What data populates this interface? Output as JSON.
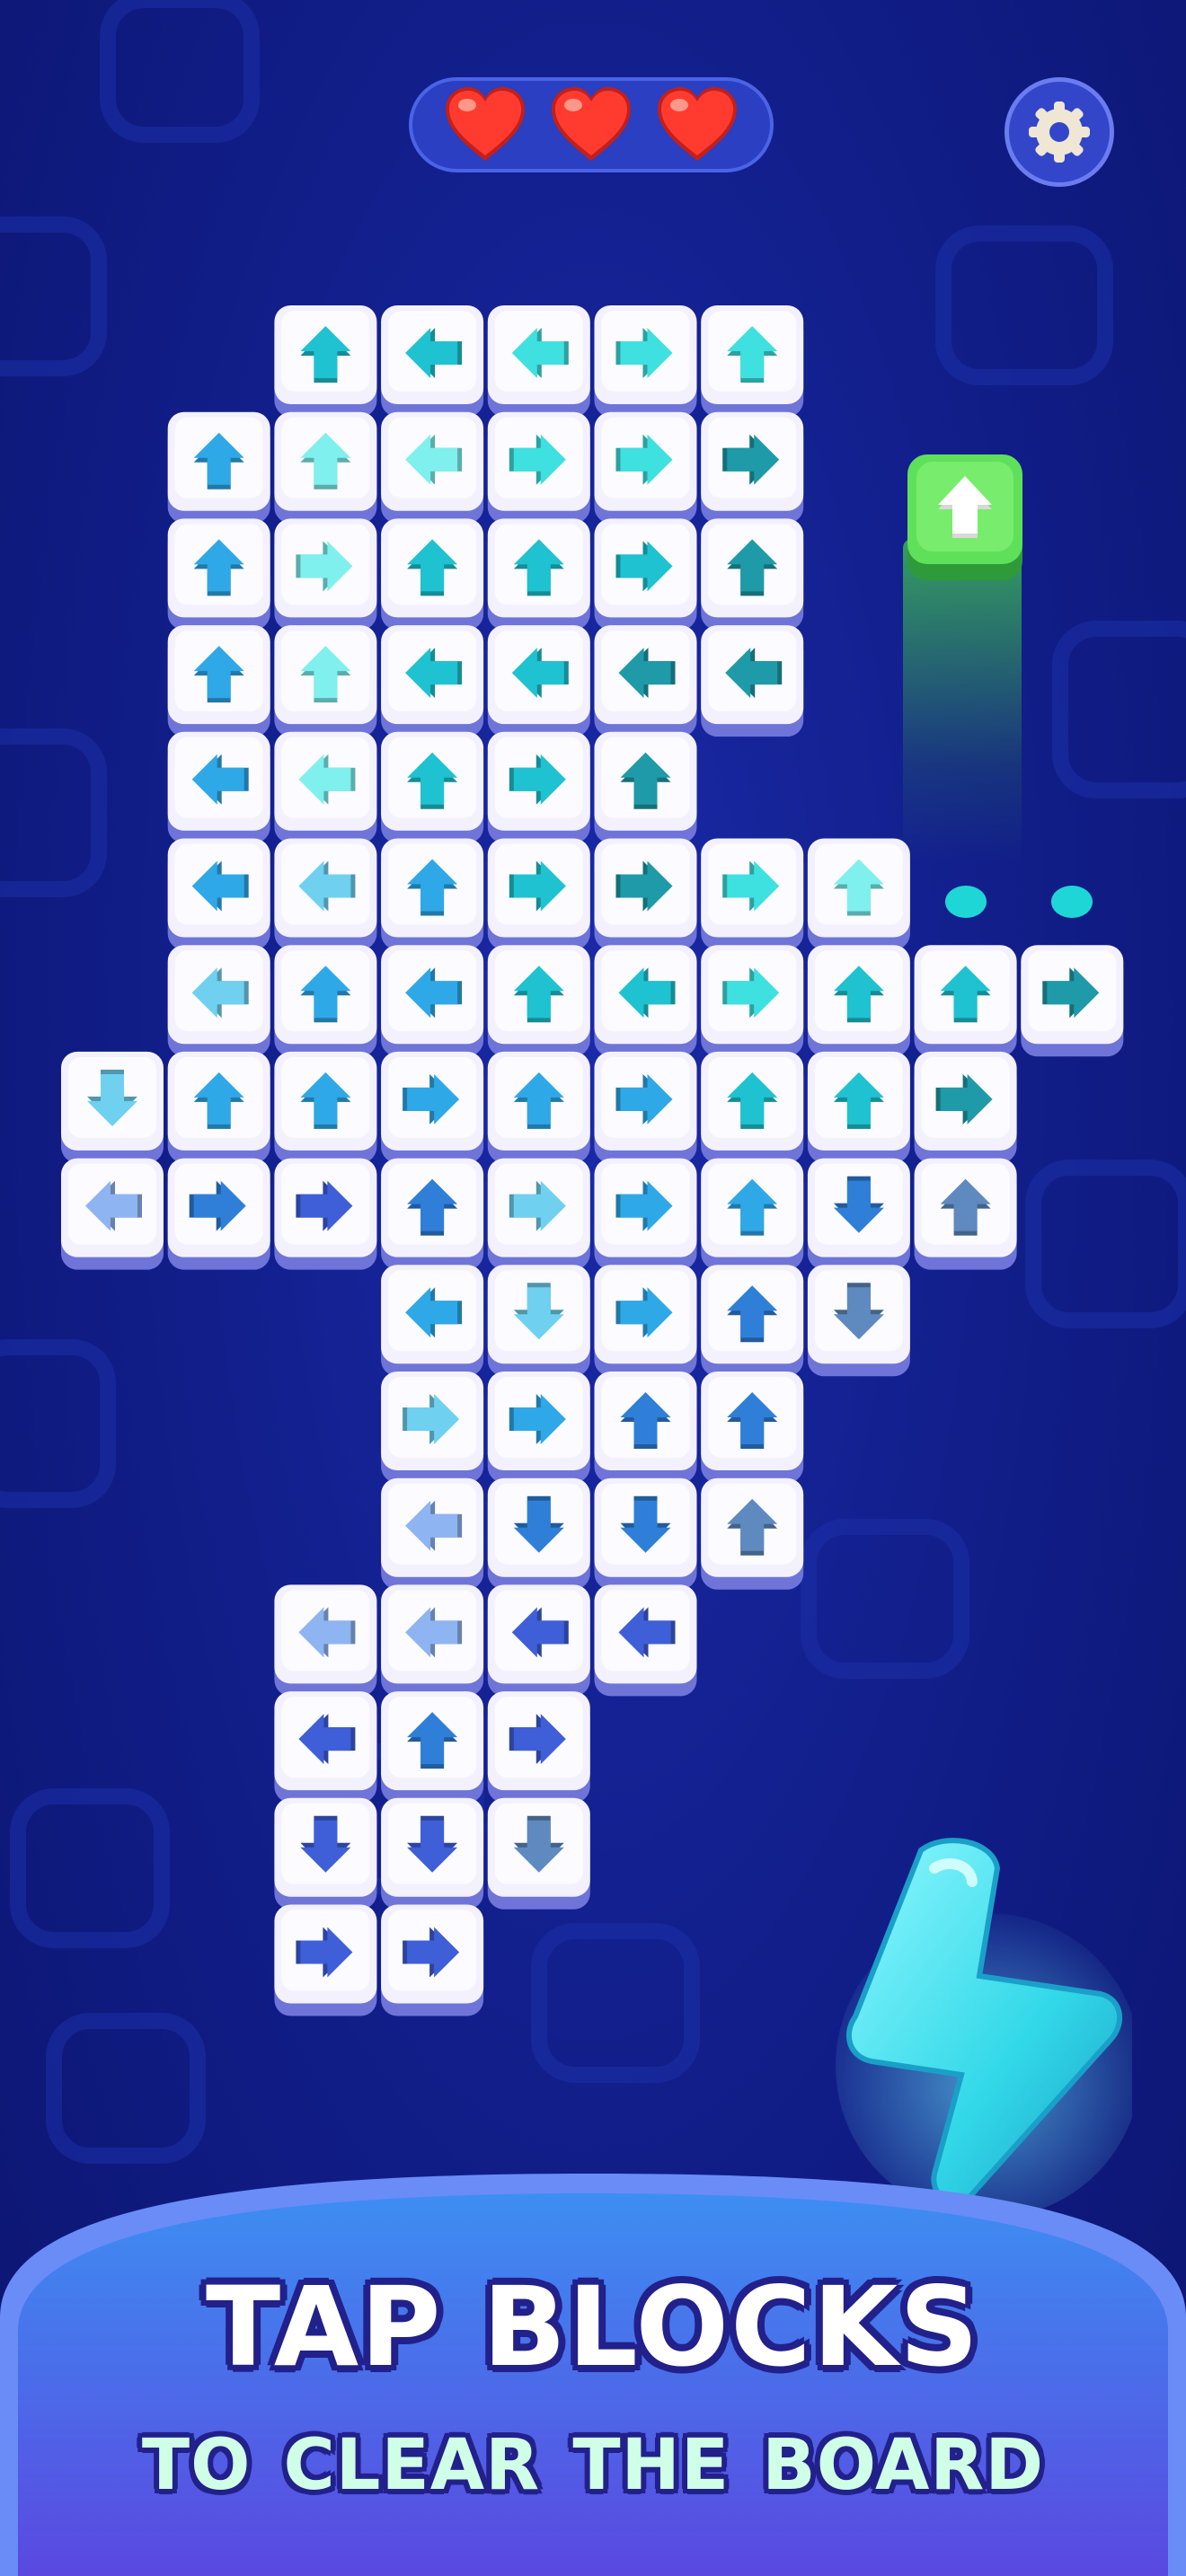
{
  "hud": {
    "lives": 3,
    "heart_icon": "heart-icon",
    "settings_icon": "gear-icon",
    "colors": {
      "heart": "#ff3b2f",
      "pill": "#2a3fc2",
      "settings_ring": "#6a7cf0"
    }
  },
  "board": {
    "tile_colors": {
      "teal": "#1fc2d0",
      "aqua": "#3fe0e0",
      "mint": "#7ff0ee",
      "dark_teal": "#1f9aa8",
      "light_blue": "#6fd0f0",
      "sky": "#2fa8e8",
      "blue": "#2f7fd8",
      "periwinkle": "#8fb4f2",
      "indigo": "#3f5fd8",
      "slate": "#5f8ac0"
    },
    "rows": [
      {
        "row": 0,
        "cells": [
          [
            2,
            "up",
            "teal"
          ],
          [
            3,
            "left",
            "teal"
          ],
          [
            4,
            "left",
            "aqua"
          ],
          [
            5,
            "right",
            "aqua"
          ],
          [
            6,
            "up",
            "aqua"
          ]
        ]
      },
      {
        "row": 1,
        "cells": [
          [
            1,
            "up",
            "sky"
          ],
          [
            2,
            "up",
            "mint"
          ],
          [
            3,
            "left",
            "mint"
          ],
          [
            4,
            "right",
            "aqua"
          ],
          [
            5,
            "right",
            "aqua"
          ],
          [
            6,
            "right",
            "dark_teal"
          ]
        ]
      },
      {
        "row": 2,
        "cells": [
          [
            1,
            "up",
            "sky"
          ],
          [
            2,
            "right",
            "mint"
          ],
          [
            3,
            "up",
            "teal"
          ],
          [
            4,
            "up",
            "teal"
          ],
          [
            5,
            "right",
            "teal"
          ],
          [
            6,
            "up",
            "dark_teal"
          ]
        ]
      },
      {
        "row": 3,
        "cells": [
          [
            1,
            "up",
            "sky"
          ],
          [
            2,
            "up",
            "mint"
          ],
          [
            3,
            "left",
            "teal"
          ],
          [
            4,
            "left",
            "teal"
          ],
          [
            5,
            "left",
            "dark_teal"
          ],
          [
            6,
            "left",
            "dark_teal"
          ]
        ]
      },
      {
        "row": 4,
        "cells": [
          [
            1,
            "left",
            "sky"
          ],
          [
            2,
            "left",
            "mint"
          ],
          [
            3,
            "up",
            "teal"
          ],
          [
            4,
            "right",
            "teal"
          ],
          [
            5,
            "up",
            "dark_teal"
          ]
        ]
      },
      {
        "row": 5,
        "cells": [
          [
            1,
            "left",
            "sky"
          ],
          [
            2,
            "left",
            "light_blue"
          ],
          [
            3,
            "up",
            "sky"
          ],
          [
            4,
            "right",
            "teal"
          ],
          [
            5,
            "right",
            "dark_teal"
          ],
          [
            6,
            "right",
            "aqua"
          ],
          [
            7,
            "up",
            "mint"
          ]
        ]
      },
      {
        "row": 6,
        "cells": [
          [
            1,
            "left",
            "light_blue"
          ],
          [
            2,
            "up",
            "sky"
          ],
          [
            3,
            "left",
            "sky"
          ],
          [
            4,
            "up",
            "teal"
          ],
          [
            5,
            "left",
            "teal"
          ],
          [
            6,
            "right",
            "aqua"
          ],
          [
            7,
            "up",
            "teal"
          ],
          [
            8,
            "up",
            "teal"
          ],
          [
            9,
            "right",
            "dark_teal"
          ]
        ]
      },
      {
        "row": 7,
        "cells": [
          [
            0,
            "down",
            "light_blue"
          ],
          [
            1,
            "up",
            "sky"
          ],
          [
            2,
            "up",
            "sky"
          ],
          [
            3,
            "right",
            "sky"
          ],
          [
            4,
            "up",
            "sky"
          ],
          [
            5,
            "right",
            "sky"
          ],
          [
            6,
            "up",
            "teal"
          ],
          [
            7,
            "up",
            "teal"
          ],
          [
            8,
            "right",
            "dark_teal"
          ]
        ]
      },
      {
        "row": 8,
        "cells": [
          [
            0,
            "left",
            "periwinkle"
          ],
          [
            1,
            "right",
            "blue"
          ],
          [
            2,
            "right",
            "indigo"
          ],
          [
            3,
            "up",
            "blue"
          ],
          [
            4,
            "right",
            "light_blue"
          ],
          [
            5,
            "right",
            "sky"
          ],
          [
            6,
            "up",
            "sky"
          ],
          [
            7,
            "down",
            "blue"
          ],
          [
            8,
            "up",
            "slate"
          ]
        ]
      },
      {
        "row": 9,
        "cells": [
          [
            3,
            "left",
            "sky"
          ],
          [
            4,
            "down",
            "light_blue"
          ],
          [
            5,
            "right",
            "sky"
          ],
          [
            6,
            "up",
            "blue"
          ],
          [
            7,
            "down",
            "slate"
          ]
        ]
      },
      {
        "row": 10,
        "cells": [
          [
            3,
            "right",
            "light_blue"
          ],
          [
            4,
            "right",
            "sky"
          ],
          [
            5,
            "up",
            "blue"
          ],
          [
            6,
            "up",
            "blue"
          ]
        ]
      },
      {
        "row": 11,
        "cells": [
          [
            3,
            "left",
            "periwinkle"
          ],
          [
            4,
            "down",
            "blue"
          ],
          [
            5,
            "down",
            "blue"
          ],
          [
            6,
            "up",
            "slate"
          ]
        ]
      },
      {
        "row": 12,
        "cells": [
          [
            2,
            "left",
            "periwinkle"
          ],
          [
            3,
            "left",
            "periwinkle"
          ],
          [
            4,
            "left",
            "indigo"
          ],
          [
            5,
            "left",
            "indigo"
          ]
        ]
      },
      {
        "row": 13,
        "cells": [
          [
            2,
            "left",
            "indigo"
          ],
          [
            3,
            "up",
            "blue"
          ],
          [
            4,
            "right",
            "indigo"
          ]
        ]
      },
      {
        "row": 14,
        "cells": [
          [
            2,
            "down",
            "indigo"
          ],
          [
            3,
            "down",
            "indigo"
          ],
          [
            4,
            "down",
            "slate"
          ]
        ]
      },
      {
        "row": 15,
        "cells": [
          [
            2,
            "right",
            "indigo"
          ],
          [
            3,
            "right",
            "indigo"
          ]
        ]
      }
    ]
  },
  "launcher": {
    "direction": "up",
    "icon": "arrow-up-icon",
    "color": "#4fd64f"
  },
  "booster": {
    "icon": "lightning-icon",
    "color": "#3fe6d6"
  },
  "banner": {
    "title": "TAP BLOCKS",
    "subtitle": "TO  CLEAR THE BOARD"
  }
}
